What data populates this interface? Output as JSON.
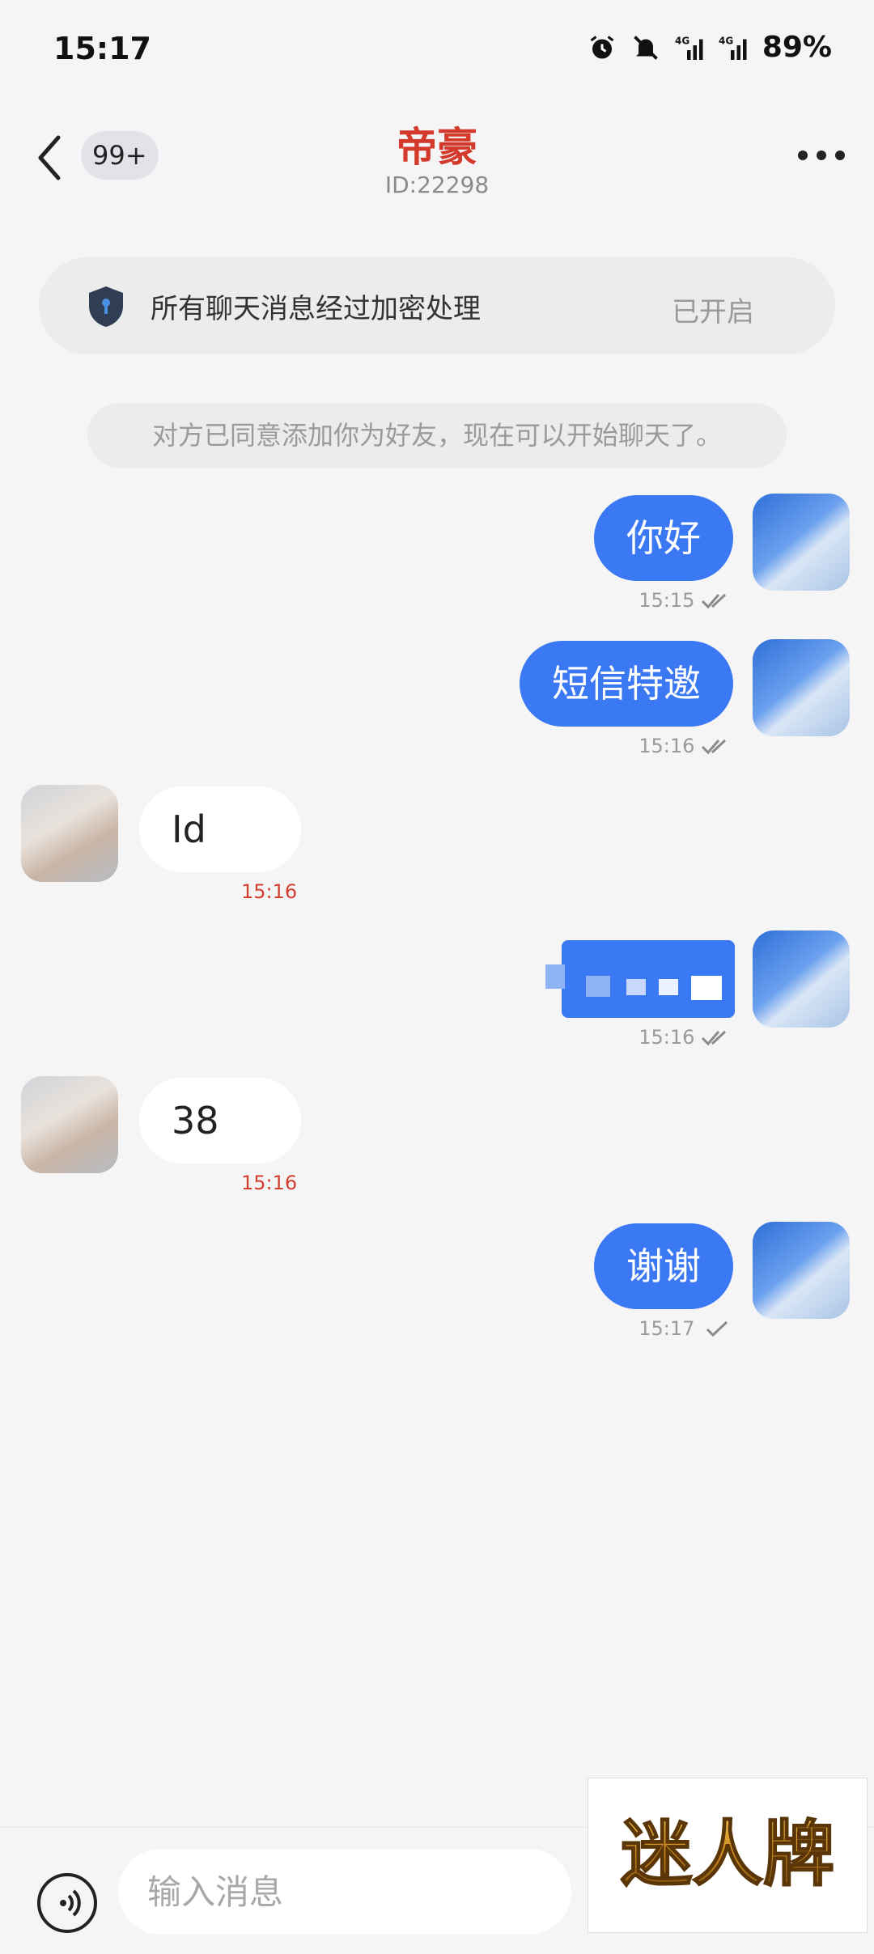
{
  "status_bar": {
    "time": "15:17",
    "battery": "89%",
    "icons": [
      "alarm-icon",
      "bell-off-icon",
      "signal-4g-icon",
      "signal-4g-2-icon"
    ]
  },
  "header": {
    "back_badge": "99+",
    "title": "帝豪",
    "subtitle": "ID:22298"
  },
  "encryption": {
    "text": "所有聊天消息经过加密处理",
    "status": "已开启"
  },
  "system_notice": "对方已同意添加你为好友，现在可以开始聊天了。",
  "messages": [
    {
      "direction": "out",
      "text": "你好",
      "time": "15:15",
      "read": "double-check"
    },
    {
      "direction": "out",
      "text": "短信特邀",
      "time": "15:16",
      "read": "double-check"
    },
    {
      "direction": "in",
      "text": "Id",
      "time": "15:16"
    },
    {
      "direction": "out",
      "text": "",
      "time": "15:16",
      "read": "double-check",
      "obscured": true
    },
    {
      "direction": "in",
      "text": "38",
      "time": "15:16"
    },
    {
      "direction": "out",
      "text": "谢谢",
      "time": "15:17",
      "read": "single-check"
    }
  ],
  "input": {
    "placeholder": "输入消息"
  },
  "watermark": "迷人牌",
  "colors": {
    "accent_blue": "#3b78f3",
    "title_red": "#d33a2c",
    "background": "#f5f5f5"
  }
}
